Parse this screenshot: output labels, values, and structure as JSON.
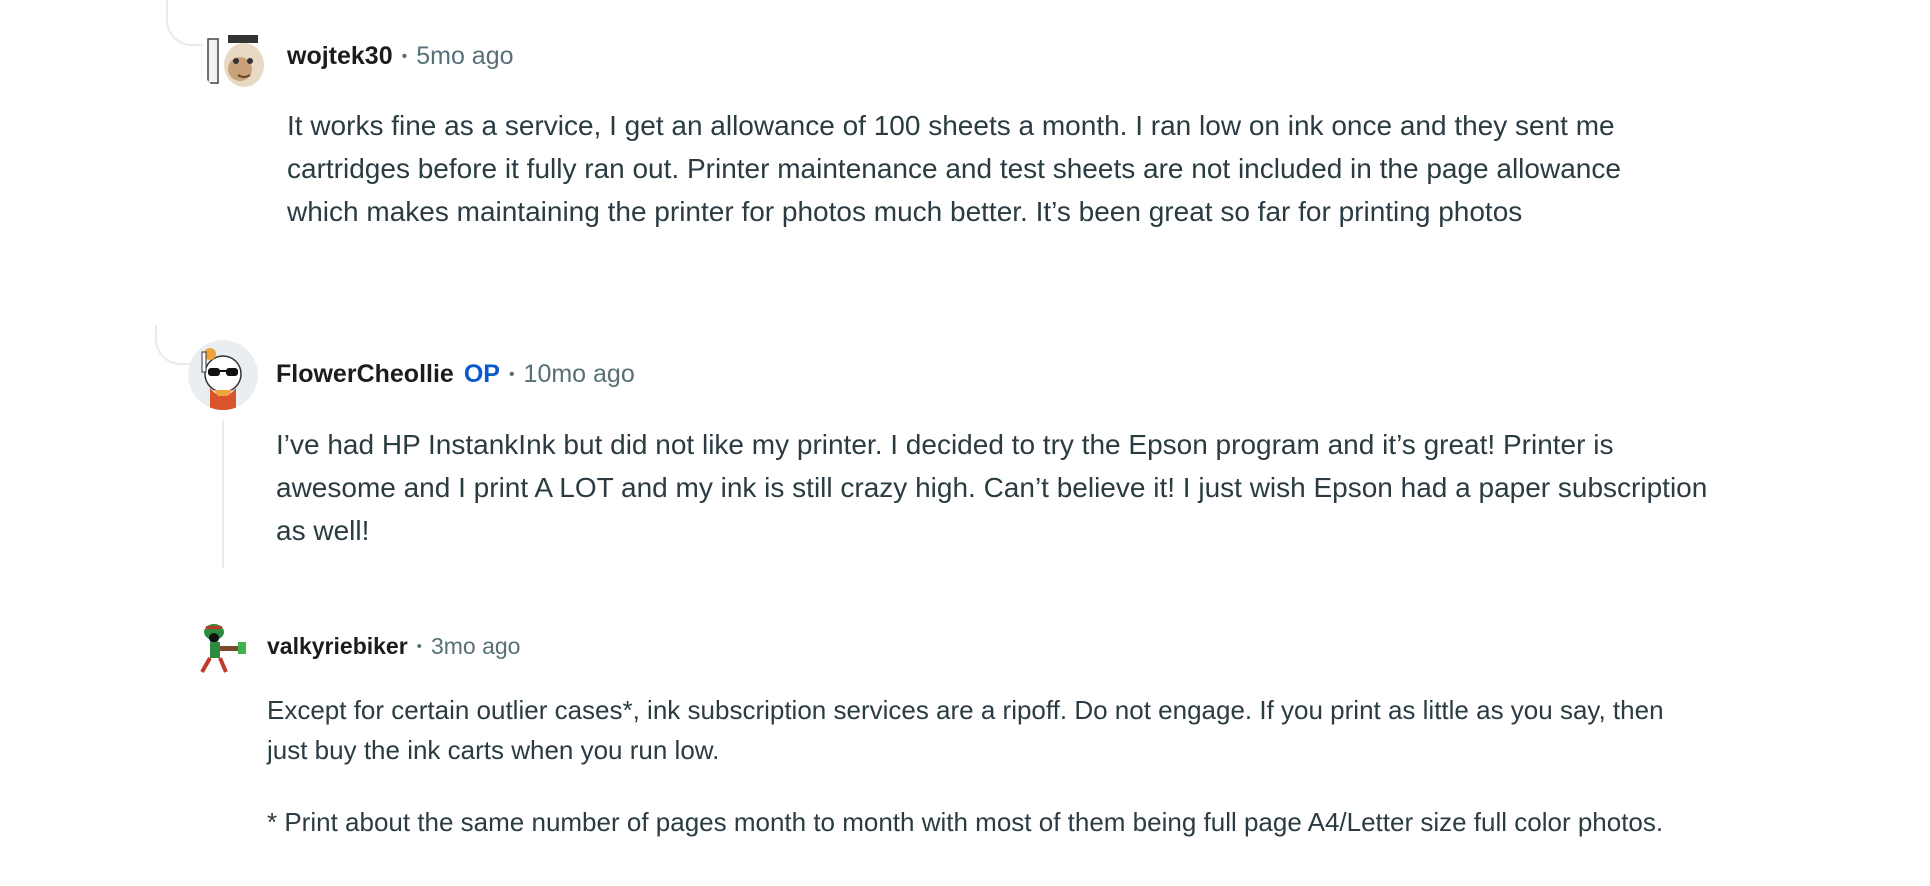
{
  "comments": [
    {
      "author": "wojtek30",
      "op_badge": "",
      "separator": "•",
      "time": "5mo ago",
      "paragraphs": [
        "It works fine as a service, I get an allowance of 100 sheets a month. I ran low on ink once and they sent me cartridges before it fully ran out. Printer maintenance and test sheets are not included in the page allowance which makes maintaining the printer for photos much better. It’s been great so far for printing photos"
      ]
    },
    {
      "author": "FlowerCheollie",
      "op_badge": "OP",
      "separator": "•",
      "time": "10mo ago",
      "paragraphs": [
        "I’ve had HP InstankInk but did not like my printer. I decided to try the Epson program and it’s great! Printer is awesome and I print A LOT and my ink is still crazy high. Can’t believe it! I just wish Epson had a paper subscription as well!"
      ]
    },
    {
      "author": "valkyriebiker",
      "op_badge": "",
      "separator": "•",
      "time": "3mo ago",
      "paragraphs": [
        "Except for certain outlier cases*, ink subscription services are a ripoff. Do not engage. If you print as little as you say, then just buy the ink carts when you run low.",
        "* Print about the same number of pages month to month with most of them being full page A4/Letter size full color photos."
      ]
    }
  ],
  "colors": {
    "author": "#1c1c1c",
    "op": "#0a58d0",
    "meta": "#576f76",
    "body": "#2a3c42",
    "thread_line": "#e5ebee"
  }
}
